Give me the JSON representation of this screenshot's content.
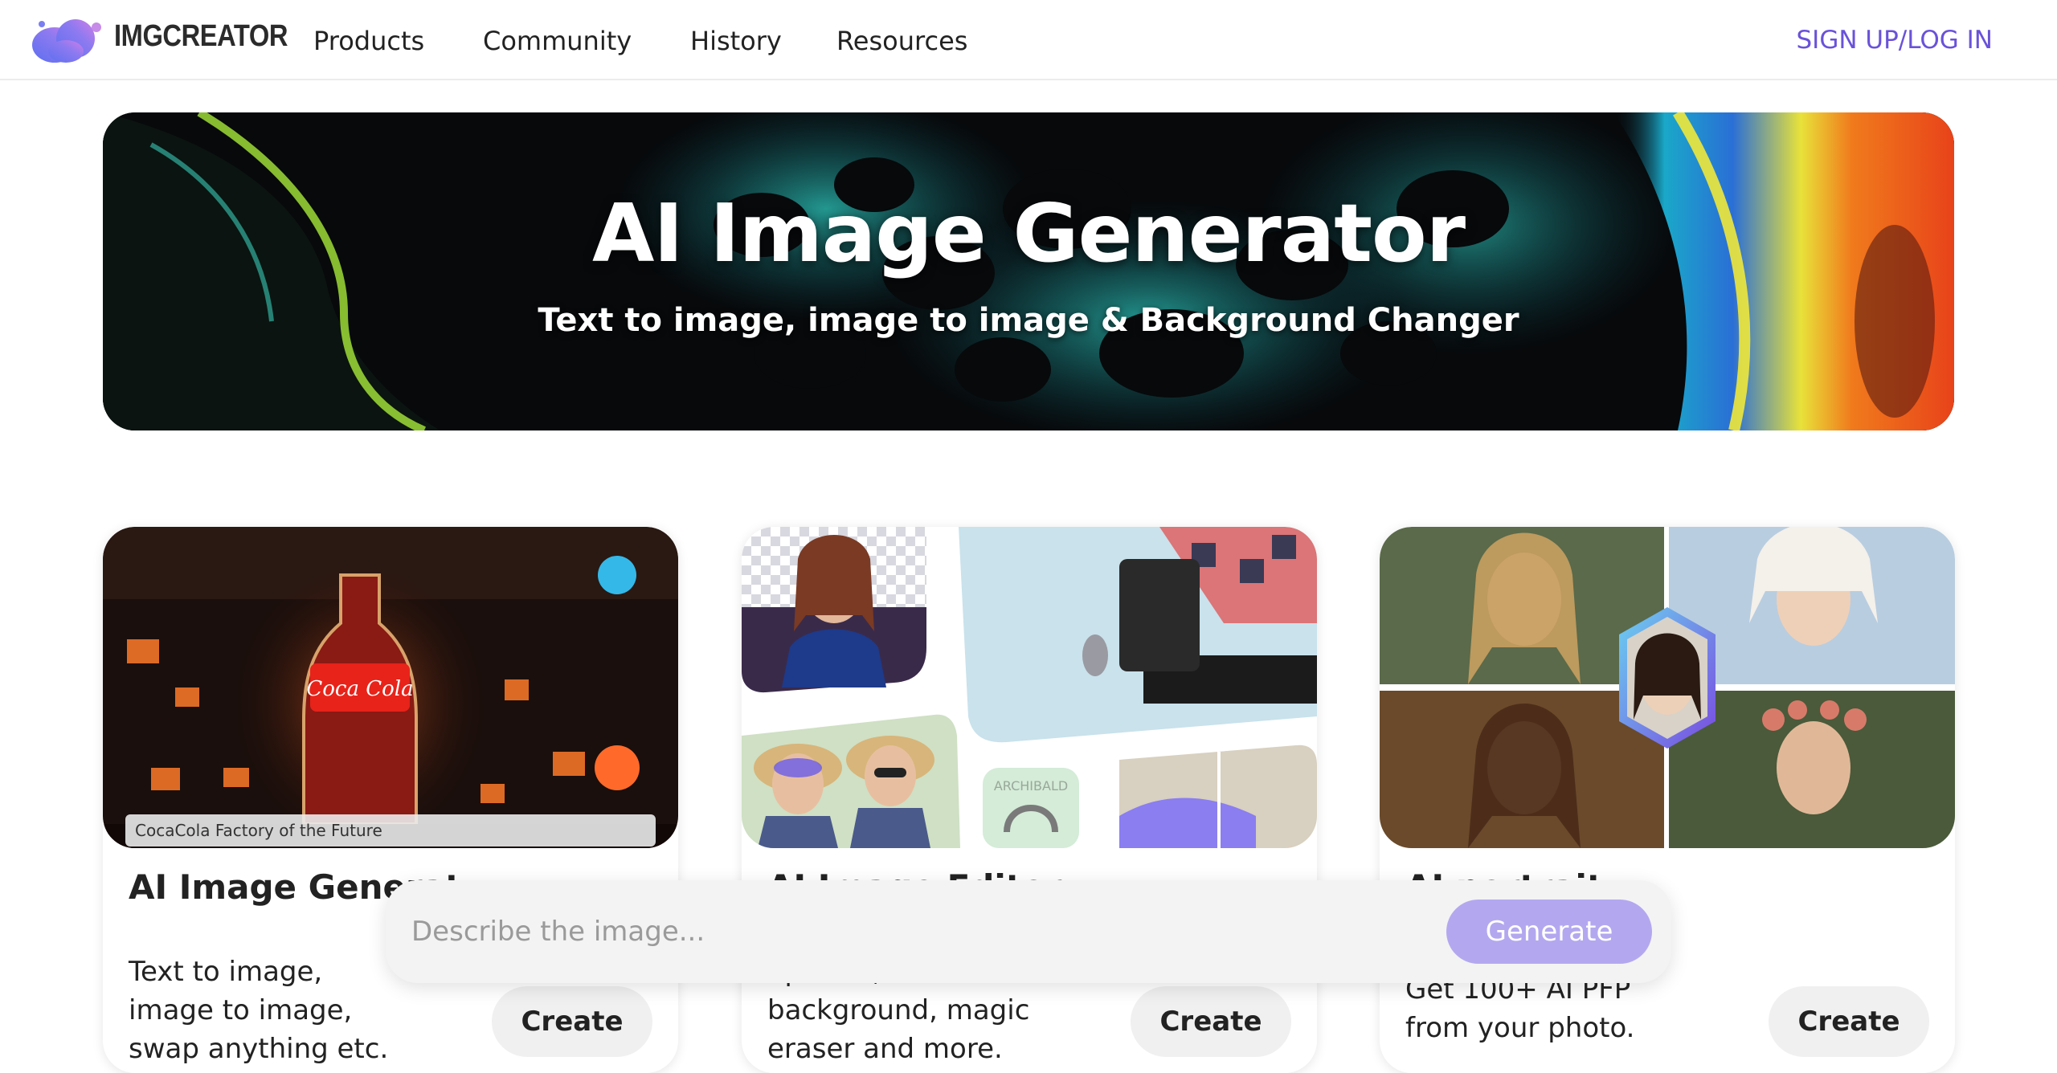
{
  "header": {
    "brand": "IMGCREATOR",
    "nav": [
      {
        "label": "Products"
      },
      {
        "label": "Community"
      },
      {
        "label": "History"
      },
      {
        "label": "Resources"
      }
    ],
    "signup_label": "SIGN UP/LOG IN",
    "accent_color": "#6a52d9"
  },
  "hero": {
    "title": "AI Image Generator",
    "subtitle": "Text to image, image to image & Background Changer"
  },
  "cards": [
    {
      "image_caption": "CocaCola Factory of the Future",
      "title": "AI Image Generat",
      "description_lines": [
        "Text to image,",
        "image to image,",
        "swap anything etc."
      ],
      "button": "Create"
    },
    {
      "image_label": "ARCHIBALD",
      "title": "AI Image Editor",
      "description_lines": [
        "upscale, remove",
        "background, magic",
        "eraser and more."
      ],
      "button": "Create"
    },
    {
      "title": "AI portrait",
      "description_lines": [
        "Get 100+ AI PFP",
        "from your photo."
      ],
      "button": "Create"
    }
  ],
  "prompt": {
    "placeholder": "Describe the image...",
    "button": "Generate",
    "button_color": "#b3a8ef"
  }
}
